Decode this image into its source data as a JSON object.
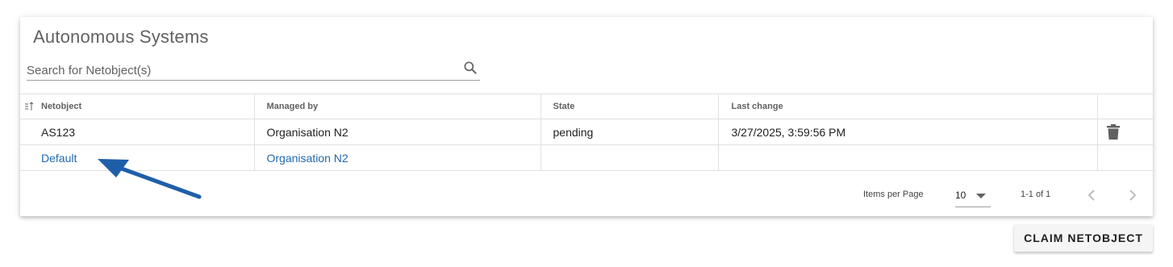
{
  "card": {
    "title": "Autonomous Systems",
    "search": {
      "placeholder": "Search for Netobject(s)",
      "value": "",
      "icon": "search-icon"
    }
  },
  "table": {
    "columns": [
      "Netobject",
      "Managed by",
      "State",
      "Last change"
    ],
    "rows": [
      {
        "netobject": "AS123",
        "managed_by": "Organisation N2",
        "state": "pending",
        "last_change": "3/27/2025, 3:59:56 PM",
        "action_icon": "trash-icon"
      },
      {
        "netobject": "Default",
        "managed_by": "Organisation N2",
        "state": "",
        "last_change": ""
      }
    ]
  },
  "paginator": {
    "items_per_page_label": "Items per Page",
    "page_size": "10",
    "range_label": "1-1 of 1"
  },
  "actions": {
    "claim_label": "CLAIM NETOBJECT"
  },
  "annotation": {
    "arrow_color": "#1f5faa"
  },
  "colors": {
    "link": "#2068b0"
  }
}
